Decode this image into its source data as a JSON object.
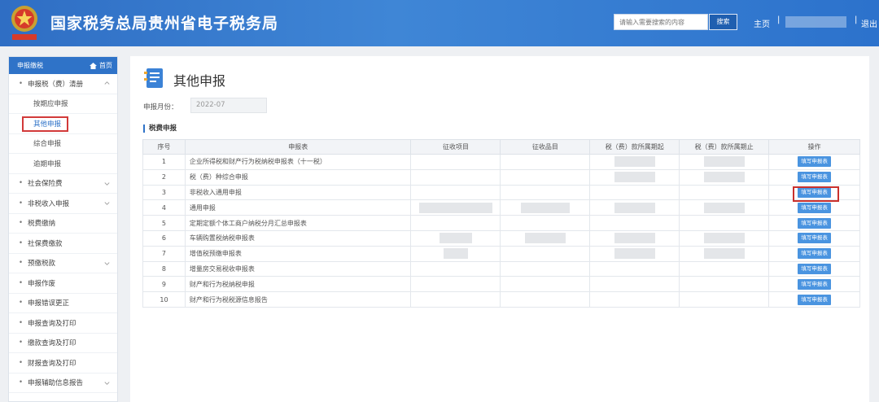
{
  "header": {
    "title": "国家税务总局贵州省电子税务局",
    "search_placeholder": "请输入需要搜索的内容",
    "search_button": "搜索",
    "home": "主页",
    "separator": "|",
    "logout": "退出"
  },
  "sidebar": {
    "head_label": "申报缴税",
    "home_label": "首页",
    "groups": [
      {
        "label": "申报税（费）清册"
      },
      {
        "label": "社会保险费"
      },
      {
        "label": "非税收入申报"
      },
      {
        "label": "税费缴纳"
      },
      {
        "label": "社保费缴款"
      },
      {
        "label": "预缴税款"
      },
      {
        "label": "申报作废"
      },
      {
        "label": "申报错误更正"
      },
      {
        "label": "申报查询及打印"
      },
      {
        "label": "缴款查询及打印"
      },
      {
        "label": "财报查询及打印"
      },
      {
        "label": "申报辅助信息报告"
      }
    ],
    "subitems": [
      {
        "label": "按期应申报"
      },
      {
        "label": "其他申报"
      },
      {
        "label": "综合申报"
      },
      {
        "label": "逾期申报"
      }
    ]
  },
  "main": {
    "title": "其他申报",
    "month_label": "申报月份：",
    "month_value": "2022-07",
    "section_title": "税费申报",
    "columns": [
      "序号",
      "申报表",
      "征收项目",
      "征收品目",
      "税（费）款所属期起",
      "税（费）款所属期止",
      "操作"
    ],
    "button_label": "填写申报表",
    "rows": [
      {
        "no": "1",
        "name": "企业所得税和财产行为税纳税申报表（十一税）"
      },
      {
        "no": "2",
        "name": "税（费）种综合申报"
      },
      {
        "no": "3",
        "name": "非税收入通用申报"
      },
      {
        "no": "4",
        "name": "通用申报"
      },
      {
        "no": "5",
        "name": "定期定额个体工商户纳税分月汇总申报表"
      },
      {
        "no": "6",
        "name": "车辆购置税纳税申报表"
      },
      {
        "no": "7",
        "name": "增值税预缴申报表"
      },
      {
        "no": "8",
        "name": "增量房交易税收申报表"
      },
      {
        "no": "9",
        "name": "财产和行为税纳税申报"
      },
      {
        "no": "10",
        "name": "财产和行为税税源信息报告"
      }
    ]
  },
  "colors": {
    "header_bg": "#3a7fd3",
    "accent": "#2f73c8",
    "button": "#4a94e0",
    "highlight_border": "#c9302c"
  }
}
